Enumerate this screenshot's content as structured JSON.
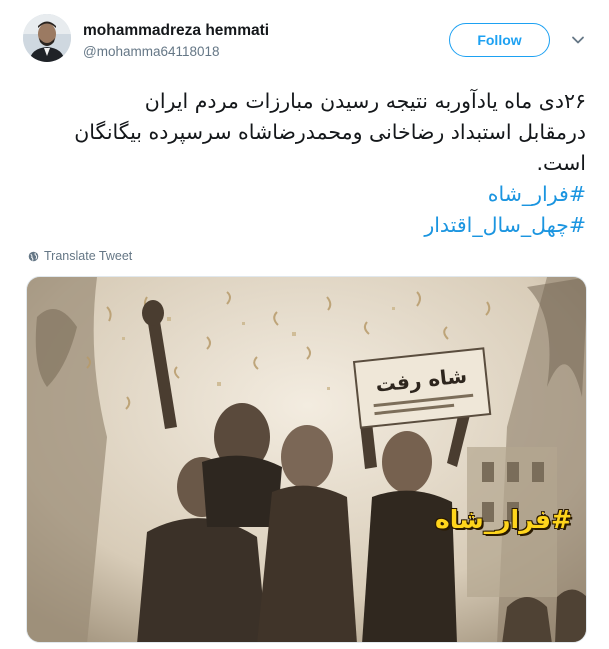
{
  "user": {
    "display_name": "mohammadreza hemmati",
    "handle": "@mohamma64118018"
  },
  "follow_button": {
    "label": "Follow"
  },
  "tweet": {
    "lines": [
      "۲۶دی ماه یادآوربه نتیجه رسیدن مبارزات مردم ایران",
      "درمقابل استبداد رضاخانی ومحمدرضاشاه سرسپرده بیگانگان",
      "است."
    ],
    "hashtags": [
      "#فرار_شاه",
      "#چهل_سال_اقتدار"
    ]
  },
  "translate": {
    "label": "Translate Tweet"
  },
  "media": {
    "placard_text": "شاه رفت",
    "overlay_hashtag": "#فرار_شاه"
  },
  "colors": {
    "accent": "#1da1f2",
    "hashtag": "#1b95e0",
    "secondary_text": "#657786",
    "overlay_text": "#ffd51c"
  }
}
